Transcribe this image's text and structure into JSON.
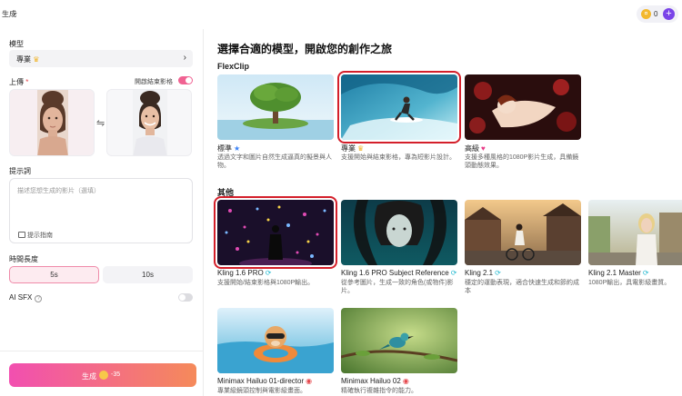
{
  "top_bar": {
    "title": "生成",
    "coin_count": "0",
    "plus_symbol": "+"
  },
  "left_panel": {
    "model_label": "模型",
    "model_value": "專業",
    "upload_label": "上傳",
    "required_mark": "*",
    "start_end_frame_label": "開啟結束影格",
    "start_end_frame_enabled": true,
    "prompt_label": "提示詞",
    "prompt_placeholder": "描述您想生成的影片（選填）",
    "prompt_guide": "提示指南",
    "duration_label": "時間長度",
    "durations": [
      {
        "label": "5s",
        "selected": true
      },
      {
        "label": "10s",
        "selected": false
      }
    ],
    "ai_sfx_label": "AI SFX",
    "ai_sfx_enabled": false,
    "generate_label": "生成",
    "generate_cost": "-35"
  },
  "main": {
    "title": "選擇合適的模型，開啟您的創作之旅",
    "groups": [
      {
        "title": "FlexClip",
        "models": [
          {
            "name": "標準",
            "badge": "star-icon",
            "description": "透過文字和圖片自然生成逼真的擬景與人物。",
            "selected": false
          },
          {
            "name": "專業",
            "badge": "crown-icon",
            "description": "支援開始與結束影格，專為短影片設計。",
            "selected": true
          },
          {
            "name": "高級",
            "badge": "heart-icon",
            "description": "支援多種風格的1080P影片生成，具備鏡頭動態效果。",
            "selected": false
          }
        ]
      },
      {
        "title": "其他",
        "models": [
          {
            "name": "Kling 1.6 PRO",
            "badge": "loop-icon",
            "description": "支援開始/結束影格與1080P輸出。",
            "selected": true
          },
          {
            "name": "Kling 1.6 PRO Subject Reference",
            "badge": "loop-icon",
            "description": "從參考圖片，生成一致的角色(或物件)影片。",
            "selected": false
          },
          {
            "name": "Kling 2.1",
            "badge": "loop-icon",
            "description": "穩定的運動表現，適合快速生成和節約成本",
            "selected": false
          },
          {
            "name": "Kling 2.1 Master",
            "badge": "loop-icon",
            "description": "1080P輸出，具電影級畫質。",
            "selected": false
          },
          {
            "name": "Minimax Hailuo 01-director",
            "badge": "red-icon",
            "description": "專業級鏡頭控制與電影級畫面。",
            "selected": false
          },
          {
            "name": "Minimax Hailuo 02",
            "badge": "red-icon",
            "description": "精確執行複雜指令的能力。",
            "selected": false
          }
        ]
      }
    ]
  },
  "colors": {
    "accent_pink": "#f06292",
    "selection_red": "#d41f2a",
    "generate_gradient_start": "#f24fb0",
    "generate_gradient_end": "#f58a5a",
    "plus_purple": "#7a44e8"
  }
}
